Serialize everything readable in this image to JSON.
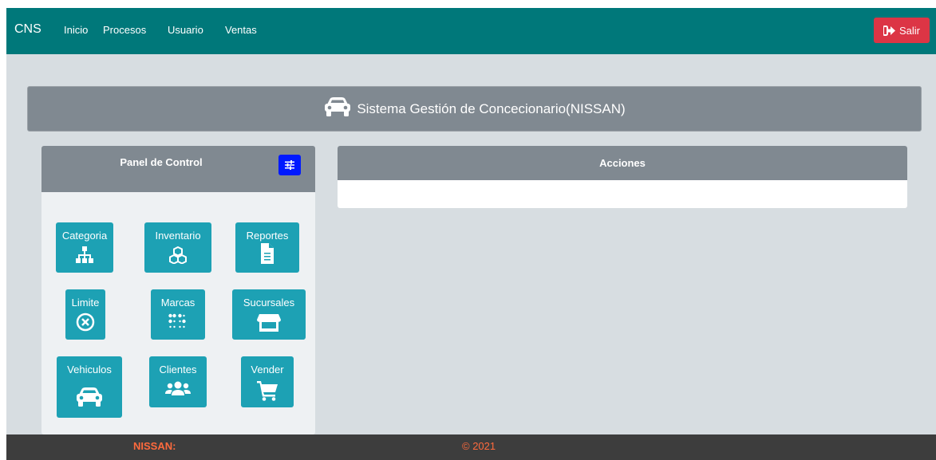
{
  "navbar": {
    "brand": "CNS",
    "links": [
      "Inicio",
      "Procesos",
      "Usuario",
      "Ventas"
    ],
    "logout_label": "Salir"
  },
  "banner": {
    "title": "Sistema Gestión de Concecionario(NISSAN)",
    "icon": "car-icon"
  },
  "panel": {
    "title": "Panel de Control",
    "tiles": [
      {
        "label": "Categoria",
        "icon": "sitemap-icon"
      },
      {
        "label": "Inventario",
        "icon": "cubes-icon"
      },
      {
        "label": "Reportes",
        "icon": "file-icon"
      },
      {
        "label": "Limite",
        "icon": "times-circle-icon"
      },
      {
        "label": "Marcas",
        "icon": "braille-icon"
      },
      {
        "label": "Sucursales",
        "icon": "store-icon"
      },
      {
        "label": "Vehiculos",
        "icon": "car-icon"
      },
      {
        "label": "Clientes",
        "icon": "users-icon"
      },
      {
        "label": "Vender",
        "icon": "cart-icon"
      }
    ]
  },
  "acciones": {
    "title": "Acciones"
  },
  "footer": {
    "brand": "NISSAN:",
    "copyright": "© 2021"
  },
  "colors": {
    "navbar": "#00787a",
    "logout": "#dc3545",
    "tile": "#1da1b4",
    "header_gray": "#808991",
    "tune_button": "#0019ff",
    "footer_text": "#ff6a3d"
  }
}
